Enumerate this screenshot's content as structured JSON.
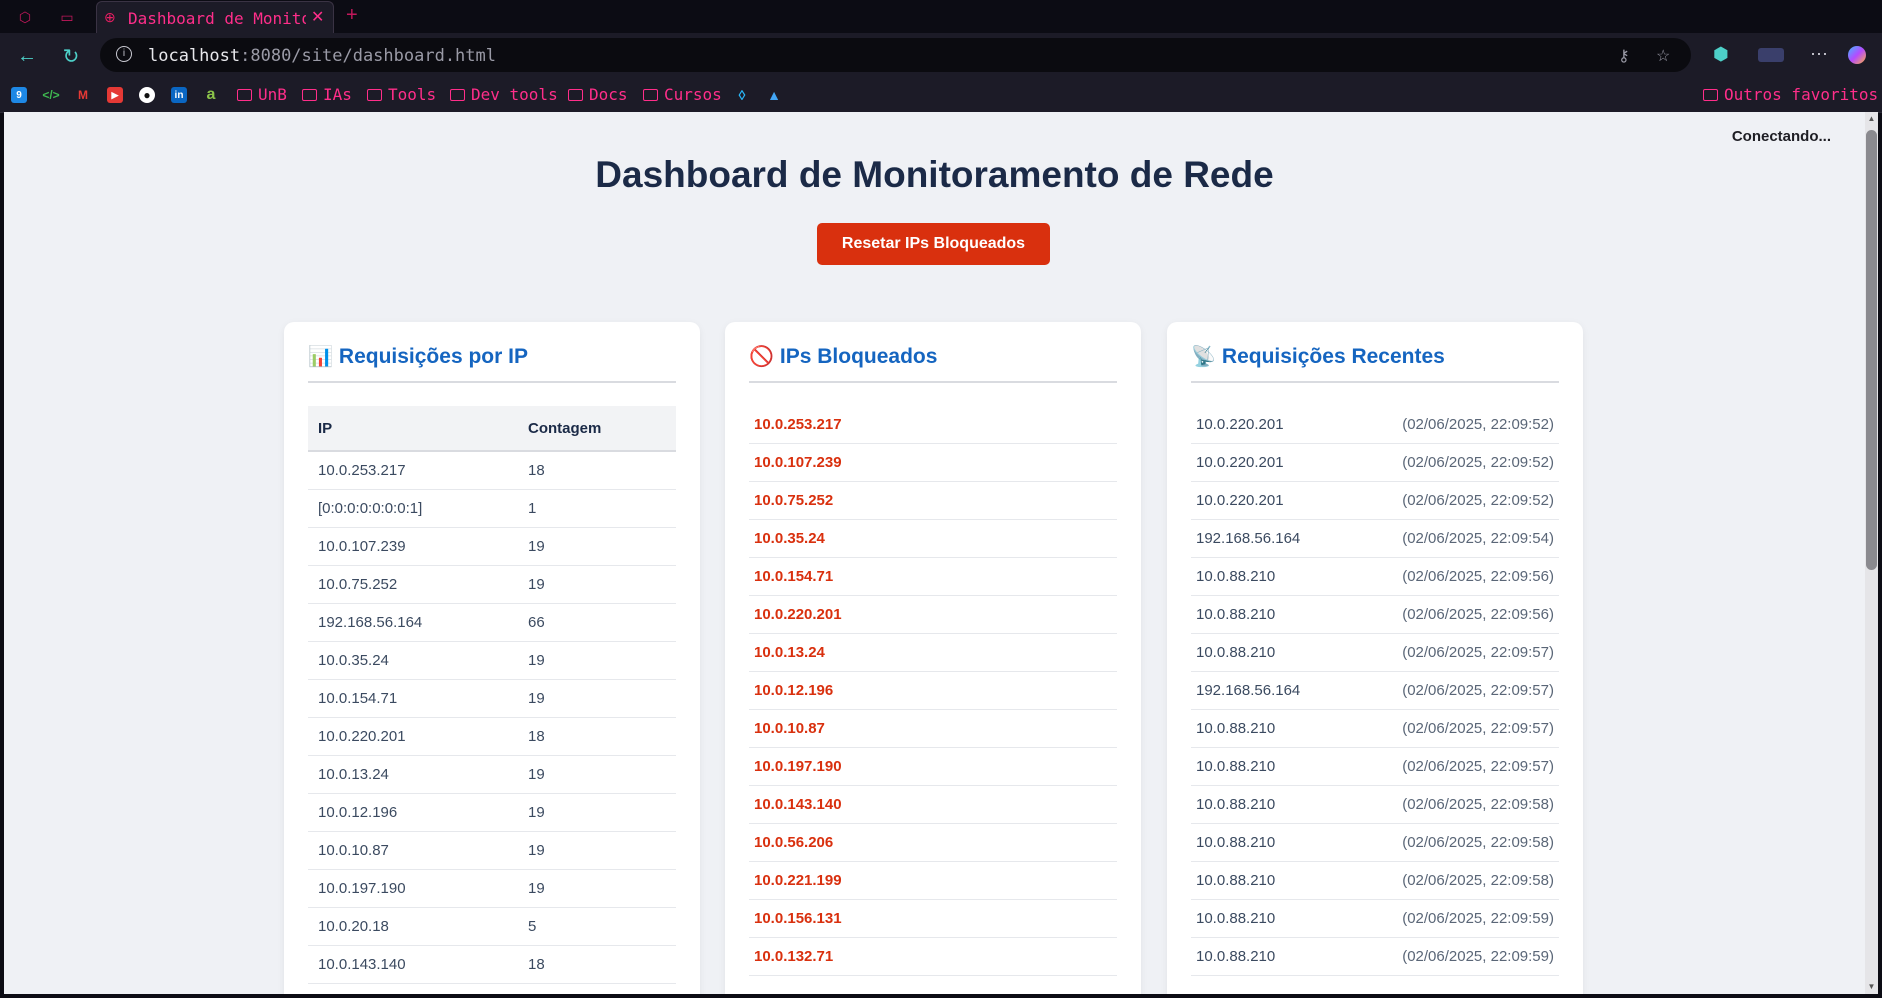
{
  "browser": {
    "tab_title": "Dashboard de Monitor",
    "url_host": "localhost",
    "url_rest": ":8080/site/dashboard.html",
    "bookmark_folders": [
      "UnB",
      "IAs",
      "Tools",
      "Dev tools",
      "Docs",
      "Cursos"
    ],
    "other_favorites": "Outros favoritos"
  },
  "page": {
    "status": "Conectando...",
    "title": "Dashboard de Monitoramento de Rede",
    "reset_button": "Resetar IPs Bloqueados"
  },
  "cards": {
    "requests": {
      "icon": "📊",
      "title": "Requisições por IP",
      "headers": [
        "IP",
        "Contagem"
      ],
      "rows": [
        [
          "10.0.253.217",
          "18"
        ],
        [
          "[0:0:0:0:0:0:0:1]",
          "1"
        ],
        [
          "10.0.107.239",
          "19"
        ],
        [
          "10.0.75.252",
          "19"
        ],
        [
          "192.168.56.164",
          "66"
        ],
        [
          "10.0.35.24",
          "19"
        ],
        [
          "10.0.154.71",
          "19"
        ],
        [
          "10.0.220.201",
          "18"
        ],
        [
          "10.0.13.24",
          "19"
        ],
        [
          "10.0.12.196",
          "19"
        ],
        [
          "10.0.10.87",
          "19"
        ],
        [
          "10.0.197.190",
          "19"
        ],
        [
          "10.0.20.18",
          "5"
        ],
        [
          "10.0.143.140",
          "18"
        ]
      ]
    },
    "blocked": {
      "icon": "🚫",
      "title": "IPs Bloqueados",
      "items": [
        "10.0.253.217",
        "10.0.107.239",
        "10.0.75.252",
        "10.0.35.24",
        "10.0.154.71",
        "10.0.220.201",
        "10.0.13.24",
        "10.0.12.196",
        "10.0.10.87",
        "10.0.197.190",
        "10.0.143.140",
        "10.0.56.206",
        "10.0.221.199",
        "10.0.156.131",
        "10.0.132.71"
      ]
    },
    "recent": {
      "icon": "📡",
      "title": "Requisições Recentes",
      "items": [
        [
          "10.0.220.201",
          "(02/06/2025, 22:09:52)"
        ],
        [
          "10.0.220.201",
          "(02/06/2025, 22:09:52)"
        ],
        [
          "10.0.220.201",
          "(02/06/2025, 22:09:52)"
        ],
        [
          "192.168.56.164",
          "(02/06/2025, 22:09:54)"
        ],
        [
          "10.0.88.210",
          "(02/06/2025, 22:09:56)"
        ],
        [
          "10.0.88.210",
          "(02/06/2025, 22:09:56)"
        ],
        [
          "10.0.88.210",
          "(02/06/2025, 22:09:57)"
        ],
        [
          "192.168.56.164",
          "(02/06/2025, 22:09:57)"
        ],
        [
          "10.0.88.210",
          "(02/06/2025, 22:09:57)"
        ],
        [
          "10.0.88.210",
          "(02/06/2025, 22:09:57)"
        ],
        [
          "10.0.88.210",
          "(02/06/2025, 22:09:58)"
        ],
        [
          "10.0.88.210",
          "(02/06/2025, 22:09:58)"
        ],
        [
          "10.0.88.210",
          "(02/06/2025, 22:09:58)"
        ],
        [
          "10.0.88.210",
          "(02/06/2025, 22:09:59)"
        ],
        [
          "10.0.88.210",
          "(02/06/2025, 22:09:59)"
        ]
      ]
    }
  },
  "colors": {
    "accent_blue": "#1565c0",
    "danger_red": "#d9300e",
    "browser_pink": "#ff2e8a",
    "browser_teal": "#4dd0c8"
  }
}
